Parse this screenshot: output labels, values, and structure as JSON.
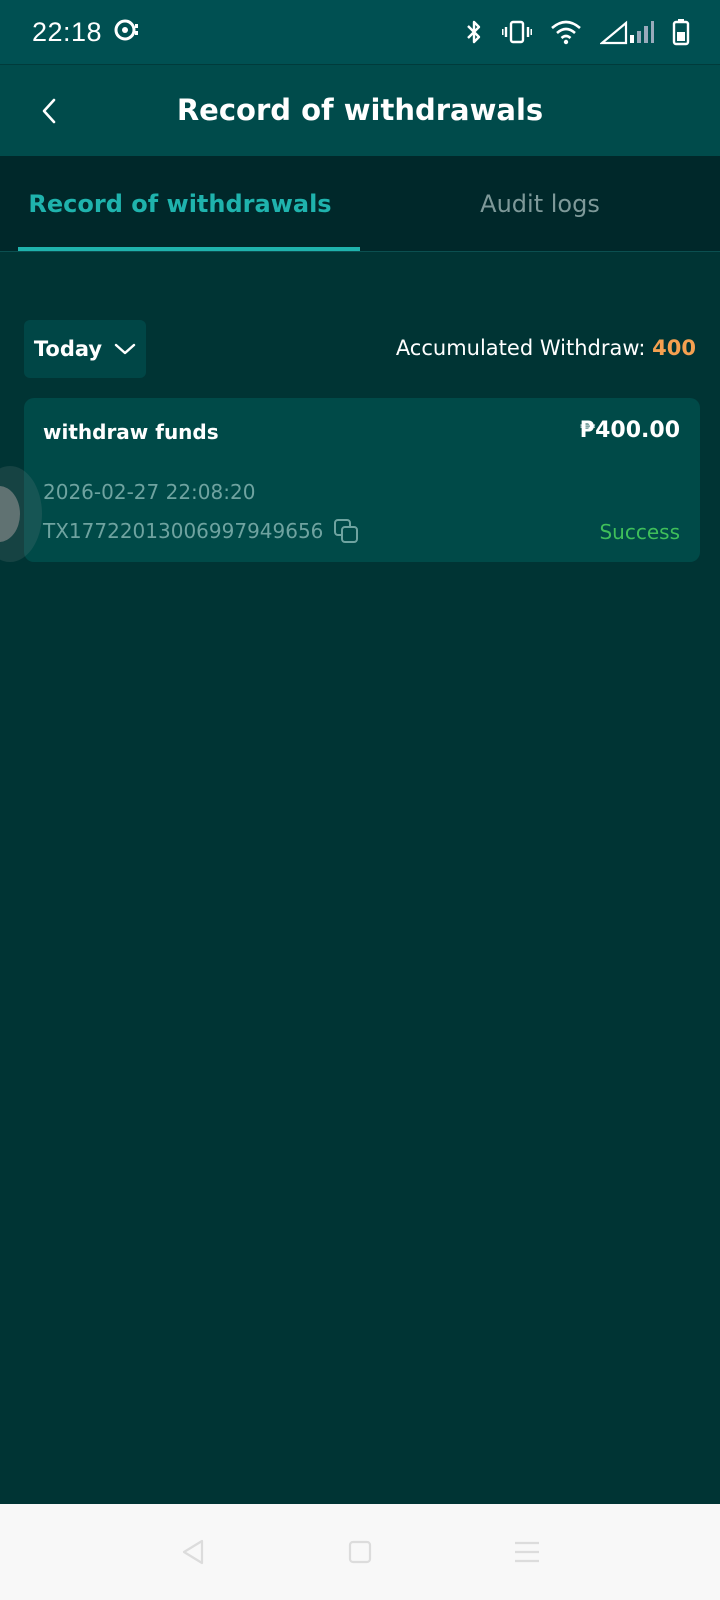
{
  "status_bar": {
    "time": "22:18"
  },
  "header": {
    "title": "Record of withdrawals",
    "back_icon": "chevron-left-icon"
  },
  "tabs": [
    {
      "label": "Record of withdrawals",
      "active": true
    },
    {
      "label": "Audit logs",
      "active": false
    }
  ],
  "filter": {
    "selected": "Today",
    "accumulated_label": "Accumulated Withdraw:",
    "accumulated_value": "400"
  },
  "records": [
    {
      "title": "withdraw funds",
      "amount": "₱400.00",
      "datetime": "2026-02-27 22:08:20",
      "txid": "TX17722013006997949656",
      "status": "Success"
    }
  ],
  "colors": {
    "accent": "#1fb3ad",
    "background": "#003434",
    "success": "#3fbf5a",
    "highlight": "#f5a050"
  }
}
